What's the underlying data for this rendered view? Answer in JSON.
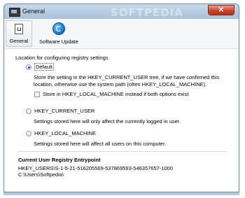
{
  "window": {
    "title": "General",
    "watermark": "SOFTPEDIA",
    "close_glyph": "✕"
  },
  "toolbar": {
    "general_label": "General",
    "update_label": "Software Update"
  },
  "settings": {
    "section_label": "Location for configuring registry settings",
    "default_label": "Default",
    "default_desc_line1": "Store the setting in the HKEY_CURRENT_USER tree, if we have confirmed this",
    "default_desc_line2": "location, otherwise use the system path (often HKEY_LOCAL_MACHINE).",
    "checkbox_label": "Store in HKEY_LOCAL_MACHINE instead if both options exist",
    "hkcu_label": "HKEY_CURRENT_USER",
    "hkcu_desc": "Settings stored here will only affect the currently logged in user.",
    "hklm_label": "HKEY_LOCAL_MACHINE",
    "hklm_desc": "Settings stored here will affect all users on this computer."
  },
  "entrypoint": {
    "label": "Current User Registry Entrypoint",
    "sid": "HKEY_USERS\\S-1-5-21-516205569-537869593-546357657-1000",
    "path": "C:\\Users\\Softpedia\\"
  }
}
